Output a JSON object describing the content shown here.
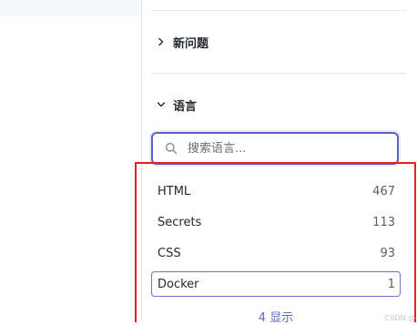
{
  "sections": {
    "new_issues": {
      "label": "新问题",
      "expanded": false
    },
    "language": {
      "label": "语言",
      "expanded": true
    }
  },
  "search": {
    "placeholder": "搜索语言..."
  },
  "languages": [
    {
      "name": "HTML",
      "count": "467",
      "selected": false
    },
    {
      "name": "Secrets",
      "count": "113",
      "selected": false
    },
    {
      "name": "CSS",
      "count": "93",
      "selected": false
    },
    {
      "name": "Docker",
      "count": "1",
      "selected": true
    }
  ],
  "show_more": "4 显示",
  "watermark": "CSDN @",
  "colors": {
    "focus_border": "#5a62c4",
    "selected_border": "#6d74c9",
    "annotation_red": "#e02020",
    "link": "#5a6bc0"
  }
}
